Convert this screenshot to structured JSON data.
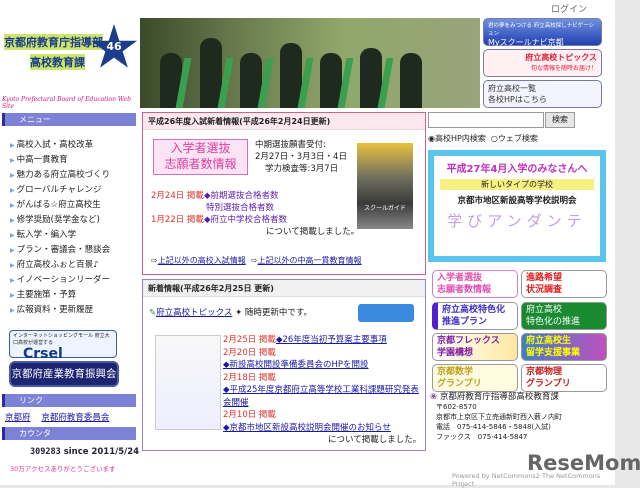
{
  "header": {
    "login": "ログイン",
    "logo_line1": "京都府教育庁指導部",
    "logo_line2": "高校教育課",
    "logo_en": "Kyoto Prefectural Board of Education Web Site",
    "logo_badge": "46"
  },
  "sidebar": {
    "menu_title": "メニュー",
    "menu": [
      "高校入試・高校改革",
      "中高一貫教育",
      "魅力ある府立高校づくり",
      "グローバルチャレンジ",
      "がんばる☆府立高校生",
      "修学奨励(奨学金など)",
      "転入学・編入学",
      "プラン・審議会・懇談会",
      "府立高校ふぉと百景♪",
      "イノベーションリーダー",
      "主要施策・予算",
      "広報資料・更新履歴"
    ],
    "crsel_caption": "インターネットショッピングモール 府立大口高校が運営する",
    "crsel": "Crsel",
    "shinko": "京都府産業教育振興会",
    "link_title": "リンク",
    "links": [
      "京都府",
      "京都府教育委員会"
    ],
    "counter_title": "カウンタ",
    "counter": "309283",
    "since": "since 2011/5/24",
    "counter_note": "30万アクセスありがとうございます"
  },
  "top_banners": [
    {
      "l1": "君の夢をみつける 府立高校探しナビゲーション",
      "l2": "Myスクールナビ京都"
    },
    {
      "l1": "府立高校トピックス",
      "l2": "旬な情報を随時お届け！"
    },
    {
      "l1": "府立高校一覧",
      "l2": "各校HPはこちら"
    }
  ],
  "exam": {
    "title": "平成26年度入試新着情報(平成26年2月24日更新)",
    "banner1": "入学者選抜",
    "banner2": "志願者数情報",
    "sched1": "中期選抜願書受付:",
    "sched2": "2月27日・3月3日・4日",
    "sched3": "学力検査等:3月7日",
    "d1": "2月24日 掲載",
    "i1": "◆前期選抜合格者数",
    "i1b": "特別選抜合格者数",
    "d2": "1月22日 掲載",
    "i2": "◆府立中学校合格者数",
    "done": "について掲載しました。",
    "guide": "スクールガイド",
    "more1": "上記以外の高校入試情報",
    "more2": "上記以外の中高一貫教育情報"
  },
  "news": {
    "title": "新着情報(平成26年2月25日 更新)",
    "topics": "府立高校トピックス",
    "topics_note": "随時更新中です。",
    "items": [
      {
        "date": "2月25日 掲載",
        "text": "◆26年度当初予算案主要事項"
      },
      {
        "date": "2月20日 掲載",
        "text": "◆新設高校開設準備委員会のHPを開設"
      },
      {
        "date": "2月18日 掲載",
        "text": "◆平成25年度京都府立高等学校工業科課題研究発表会開催"
      },
      {
        "date": "2月10日 掲載",
        "text": "◆京都市地区新設高校説明会開催のお知らせ"
      }
    ],
    "done": "について掲載しました。"
  },
  "search": {
    "value": "",
    "button": "検索",
    "opt1": "高校HP内検索",
    "opt2": "ウェブ検索"
  },
  "promo": {
    "l1": "平成27年4月入学のみなさんへ",
    "l2": "新しいタイプの学校",
    "l3": "京都市地区新設高等学校説明会",
    "l4": "学びアンダンテ"
  },
  "buttons": [
    {
      "l1": "入学者選抜",
      "l2": "志願者数情報"
    },
    {
      "l1": "進路希望",
      "l2": "状況調査"
    },
    {
      "l1": "府立高校特色化",
      "l2": "推進プラン"
    },
    {
      "l1": "府立高校",
      "l2": "特色化の推進"
    },
    {
      "l1": "京都フレックス",
      "l2": "学園構想"
    },
    {
      "l1": "府立高校生",
      "l2": "留学支援事業"
    },
    {
      "l1": "京都数学",
      "l2": "グランプリ"
    },
    {
      "l1": "京都物理",
      "l2": "グランプリ"
    }
  ],
  "address": {
    "org": "京都府教育庁指導部高校教育課",
    "zip": "〒602-8570",
    "addr": "京都市上京区下立売通新町西入薮ノ内町",
    "tel": "電話　075-414-5846・5848(入試)",
    "fax": "ファックス　075-414-5847"
  },
  "footer": {
    "powered": "Powered by NetCommons2 The NetCommons Project",
    "watermark": "ReseMom"
  }
}
